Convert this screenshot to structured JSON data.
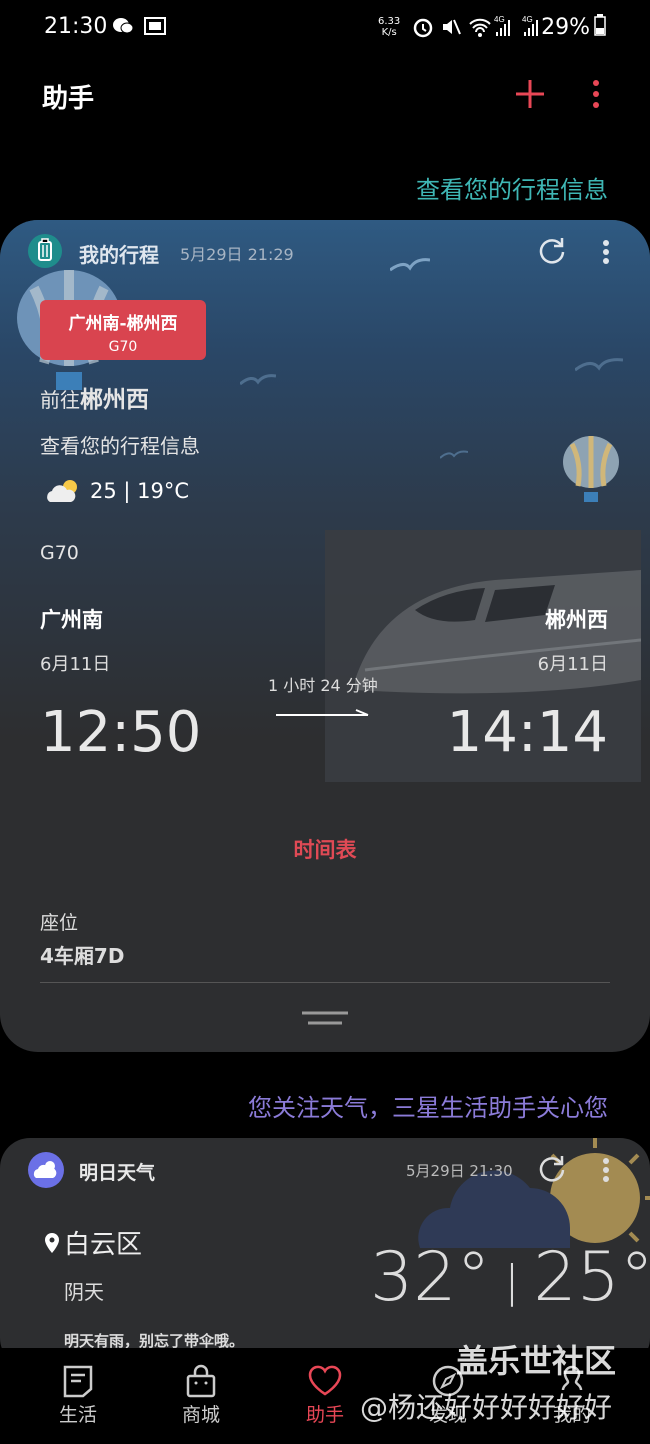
{
  "status_bar": {
    "time": "21:30",
    "speed": "6.33\nK/s",
    "battery": "29%",
    "network_4g_1": "4G",
    "network_4g_2": "4G"
  },
  "header": {
    "title": "助手"
  },
  "link_trip": "查看您的行程信息",
  "trip_card": {
    "title": "我的行程",
    "timestamp": "5月29日 21:29",
    "route": "广州南-郴州西",
    "route_train": "G70",
    "dest_prefix": "前往",
    "dest_name": "郴州西",
    "sub_info": "查看您的行程信息",
    "weather": "25 | 19°C",
    "train_no": "G70",
    "from_station": "广州南",
    "to_station": "郴州西",
    "from_date": "6月11日",
    "to_date": "6月11日",
    "duration": "1 小时 24 分钟",
    "dep_time": "12:50",
    "arr_time": "14:14",
    "timetable_label": "时间表",
    "seat_label": "座位",
    "seat_value": "4车厢7D"
  },
  "link_weather": "您关注天气，三星生活助手关心您",
  "weather_card": {
    "title": "明日天气",
    "timestamp": "5月29日 21:30",
    "location": "白云区",
    "condition": "阴天",
    "temp_high": "32°",
    "temp_low": "25°",
    "note": "明天有雨，别忘了带伞哦。"
  },
  "nav": {
    "items": [
      {
        "label": "生活",
        "icon": "note-icon"
      },
      {
        "label": "商城",
        "icon": "shopping-bag-icon"
      },
      {
        "label": "助手",
        "icon": "heart-icon"
      },
      {
        "label": "发现",
        "icon": "compass-icon"
      },
      {
        "label": "我的",
        "icon": "person-icon"
      }
    ]
  },
  "watermark": {
    "line1": "盖乐世社区",
    "line2": "@杨还好好好好好好"
  },
  "colors": {
    "accent_red": "#e84756",
    "teal": "#3fb7b5",
    "purple": "#8b7bd8"
  }
}
